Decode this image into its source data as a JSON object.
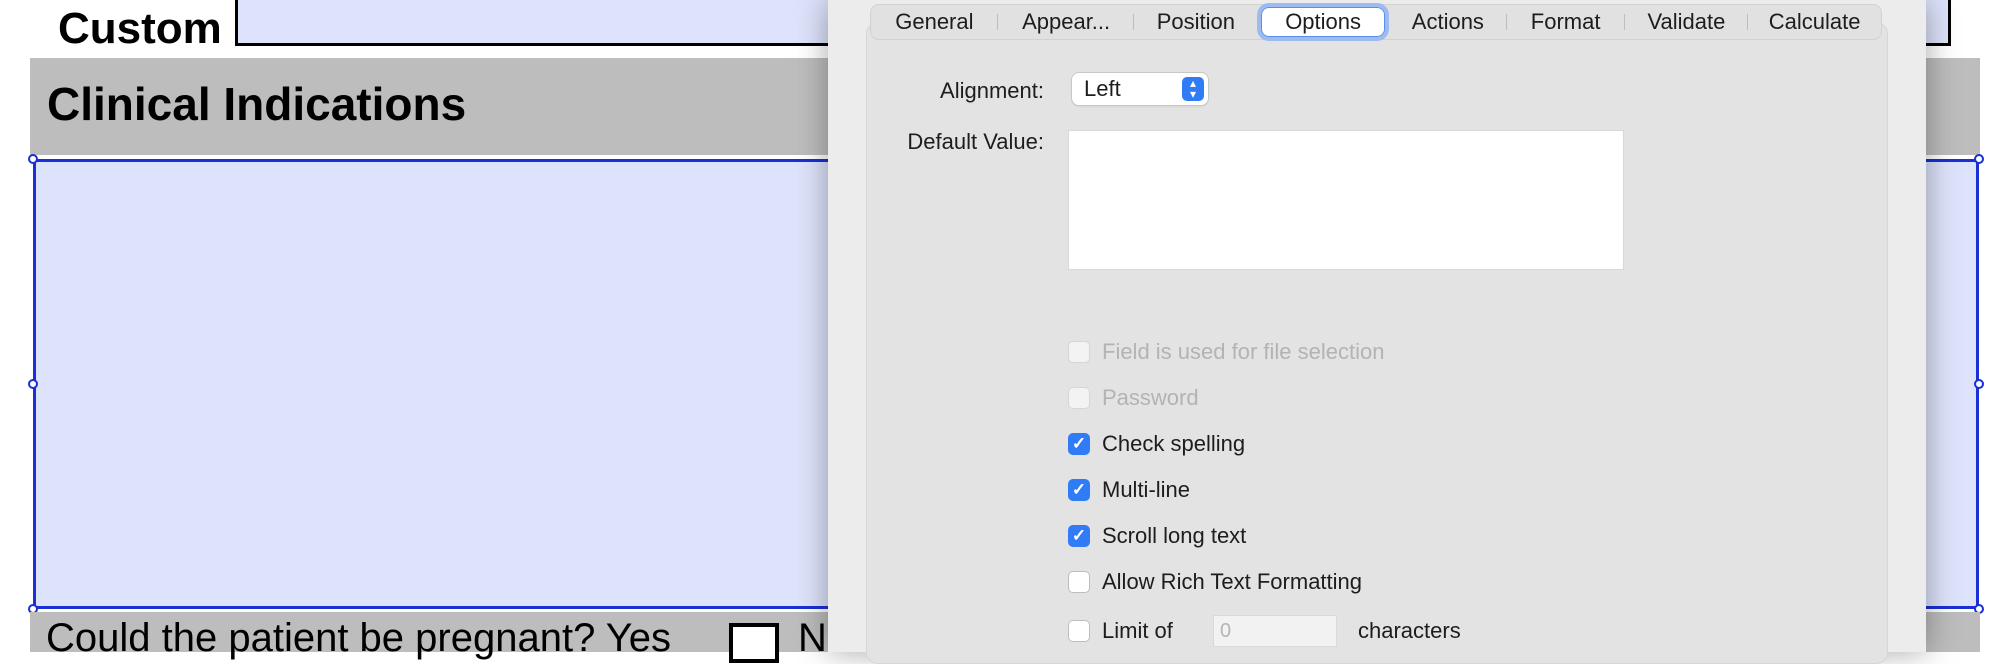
{
  "form": {
    "custom_label": "Custom",
    "section_title": "Clinical Indications",
    "question": "Could the patient be pregnant?  Yes",
    "no_partial": "N"
  },
  "dialog": {
    "tabs": [
      {
        "label": "General"
      },
      {
        "label": "Appear..."
      },
      {
        "label": "Position"
      },
      {
        "label": "Options",
        "active": true
      },
      {
        "label": "Actions"
      },
      {
        "label": "Format"
      },
      {
        "label": "Validate"
      },
      {
        "label": "Calculate"
      }
    ],
    "alignment_label": "Alignment:",
    "alignment_value": "Left",
    "default_value_label": "Default Value:",
    "default_value": "",
    "options": [
      {
        "label": "Field is used for file selection",
        "checked": false,
        "disabled": true
      },
      {
        "label": "Password",
        "checked": false,
        "disabled": true
      },
      {
        "label": "Check spelling",
        "checked": true,
        "disabled": false
      },
      {
        "label": "Multi-line",
        "checked": true,
        "disabled": false
      },
      {
        "label": "Scroll long text",
        "checked": true,
        "disabled": false
      },
      {
        "label": "Allow Rich Text Formatting",
        "checked": false,
        "disabled": false
      },
      {
        "label": "Limit of",
        "checked": false,
        "disabled": false
      }
    ],
    "limit_value": "0",
    "characters_label": "characters"
  },
  "colors": {
    "field_fill": "#dde3fb",
    "selection_border": "#1a2fd6",
    "accent": "#2f7cf6"
  }
}
